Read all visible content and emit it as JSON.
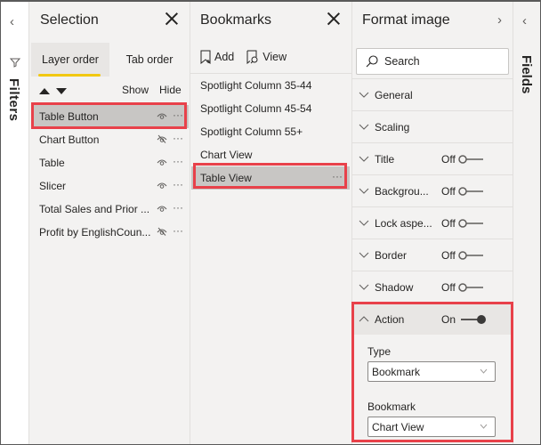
{
  "filters_pane": {
    "collapse_icon": "chevron-left-icon",
    "icon": "funnel-icon",
    "label": "Filters"
  },
  "selection": {
    "title": "Selection",
    "close_icon": "close-icon",
    "tabs": [
      {
        "label": "Layer order",
        "active": true
      },
      {
        "label": "Tab order",
        "active": false
      }
    ],
    "move_up_icon": "triangle-up-icon",
    "move_down_icon": "triangle-down-icon",
    "show_label": "Show",
    "hide_label": "Hide",
    "items": [
      {
        "name": "Table Button",
        "visible": true,
        "selected": true
      },
      {
        "name": "Chart Button",
        "visible": false,
        "selected": false
      },
      {
        "name": "Table",
        "visible": true,
        "selected": false
      },
      {
        "name": "Slicer",
        "visible": true,
        "selected": false
      },
      {
        "name": "Total Sales and Prior ...",
        "visible": true,
        "selected": false
      },
      {
        "name": "Profit by EnglishCoun...",
        "visible": false,
        "selected": false
      }
    ],
    "more_label": "···"
  },
  "bookmarks": {
    "title": "Bookmarks",
    "close_icon": "close-icon",
    "add_label": "Add",
    "view_label": "View",
    "items": [
      {
        "name": "Spotlight Column 35-44",
        "selected": false
      },
      {
        "name": "Spotlight Column 45-54",
        "selected": false
      },
      {
        "name": "Spotlight Column 55+",
        "selected": false
      },
      {
        "name": "Chart View",
        "selected": false
      },
      {
        "name": "Table View",
        "selected": true
      }
    ],
    "more_label": "···"
  },
  "format": {
    "title": "Format image",
    "expand_icon": "chevron-right-icon",
    "search_placeholder": "Search",
    "sections": [
      {
        "label": "General",
        "toggle": null
      },
      {
        "label": "Scaling",
        "toggle": null
      },
      {
        "label": "Title",
        "toggle": "Off"
      },
      {
        "label": "Backgrou...",
        "toggle": "Off"
      },
      {
        "label": "Lock aspe...",
        "toggle": "Off"
      },
      {
        "label": "Border",
        "toggle": "Off"
      },
      {
        "label": "Shadow",
        "toggle": "Off"
      }
    ],
    "action": {
      "label": "Action",
      "toggle": "On",
      "type_label": "Type",
      "type_value": "Bookmark",
      "bookmark_label": "Bookmark",
      "bookmark_value": "Chart View"
    }
  },
  "fields_pane": {
    "collapse_icon": "chevron-left-icon",
    "label": "Fields"
  },
  "colors": {
    "highlight": "#e8414a",
    "tab_underline": "#f2c811",
    "selected_row": "#c8c6c4"
  }
}
